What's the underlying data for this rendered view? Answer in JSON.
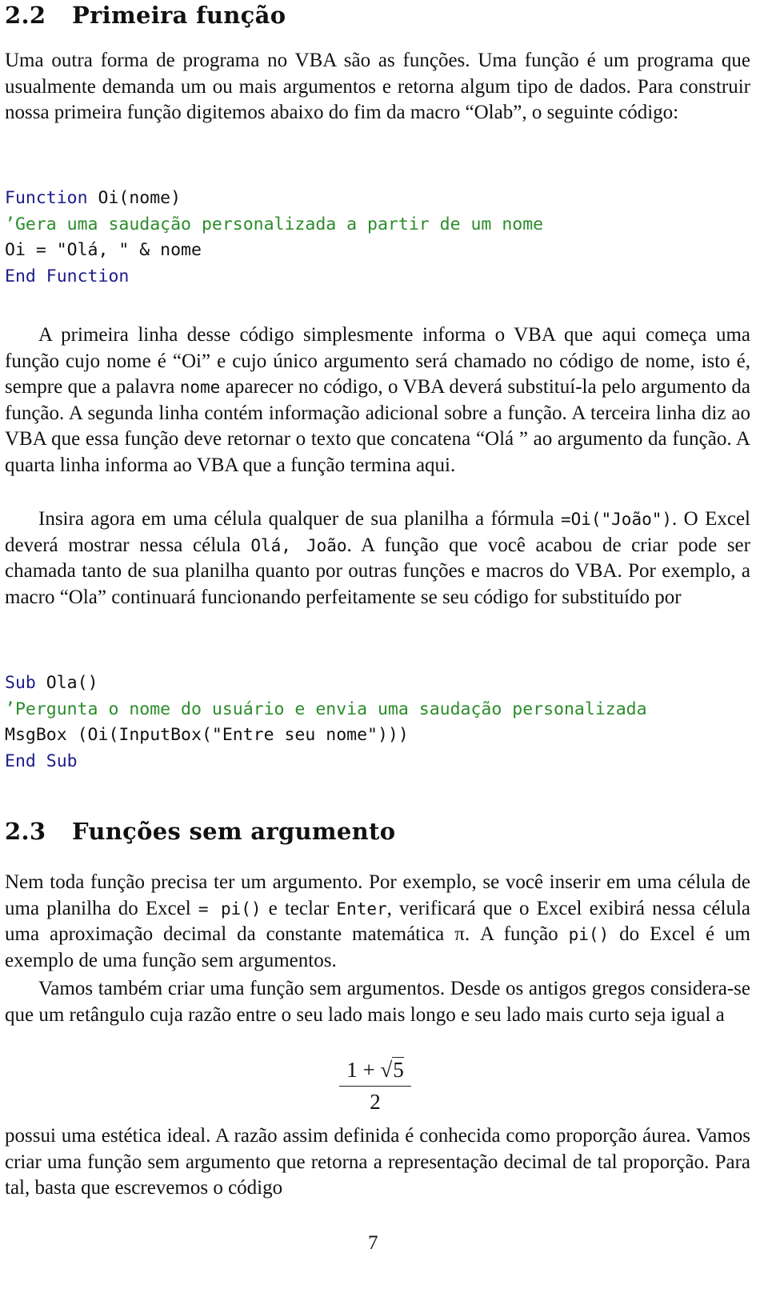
{
  "section_2_2": {
    "number": "2.2",
    "title": "Primeira função",
    "intro": "Uma outra forma de programa no VBA são as funções. Uma função é um programa que usualmente demanda um ou mais argumentos e retorna algum tipo de dados. Para construir nossa primeira função digitemos abaixo do fim da macro “Olab”, o seguinte código:",
    "code1": {
      "l1_kw": "Function",
      "l1_rest": " Oi(nome)",
      "l2_comment": "’Gera uma saudação personalizada a partir de um nome",
      "l3": "Oi = \"Olá, \" & nome",
      "l4_kw": "End Function"
    },
    "explain": "A primeira linha desse código simplesmente informa o VBA que aqui começa uma função cujo nome é “Oi” e cujo único argumento será chamado no código de nome, isto é, sempre que a palavra ",
    "explain_code": "nome",
    "explain_2": " aparecer no código, o VBA deverá substituí-la pelo argumento da função. A segunda linha contém informação adicional sobre a função. A terceira linha diz ao VBA que essa função deve retornar o texto que concatena “Olá ” ao argumento da função. A quarta linha informa ao VBA que a função termina aqui.",
    "insert_a": "Insira agora em uma célula qualquer de sua planilha a fórmula ",
    "insert_code": "=Oi(\"João\")",
    "insert_b": ". O Excel deverá mostrar nessa célula ",
    "insert_code2": "Olá, João",
    "insert_c": ". A função que você acabou de criar pode ser chamada tanto de sua planilha quanto por outras funções e macros do VBA. Por exemplo, a macro “Ola” continuará funcionando perfeitamente se seu código for substituído por",
    "code2": {
      "l1_kw": "Sub",
      "l1_rest": " Ola()",
      "l2_comment": "’Pergunta o nome do usuário e envia uma saudação personalizada",
      "l3": "MsgBox (Oi(InputBox(\"Entre seu nome\")))",
      "l4_kw": "End Sub"
    }
  },
  "section_2_3": {
    "number": "2.3",
    "title": "Funções sem argumento",
    "p1_a": "Nem toda função precisa ter um argumento. Por exemplo, se você inserir em uma célula de uma planilha do Excel ",
    "p1_code1": "= pi()",
    "p1_b": " e teclar ",
    "p1_code2": "Enter",
    "p1_c": ", verificará que o Excel exibirá nessa célula uma aproximação decimal da constante matemática π. A função ",
    "p1_code3": "pi()",
    "p1_d": " do Excel é um exemplo de uma função sem argumentos.",
    "p2": "Vamos também criar uma função sem argumentos. Desde os antigos gregos considera-se que um retângulo cuja razão entre o seu lado mais longo e seu lado mais curto seja igual a",
    "formula": {
      "num_a": "1 + √",
      "num_b": "5",
      "den": "2"
    },
    "p3": "possui uma estética ideal. A razão assim definida é conhecida como proporção áurea. Vamos criar uma função sem argumento que retorna a representação decimal de tal proporção. Para tal, basta que escrevemos o código"
  },
  "page_number": "7",
  "colors": {
    "keyword": "#1c1c8a",
    "comment": "#2b8c2b"
  }
}
